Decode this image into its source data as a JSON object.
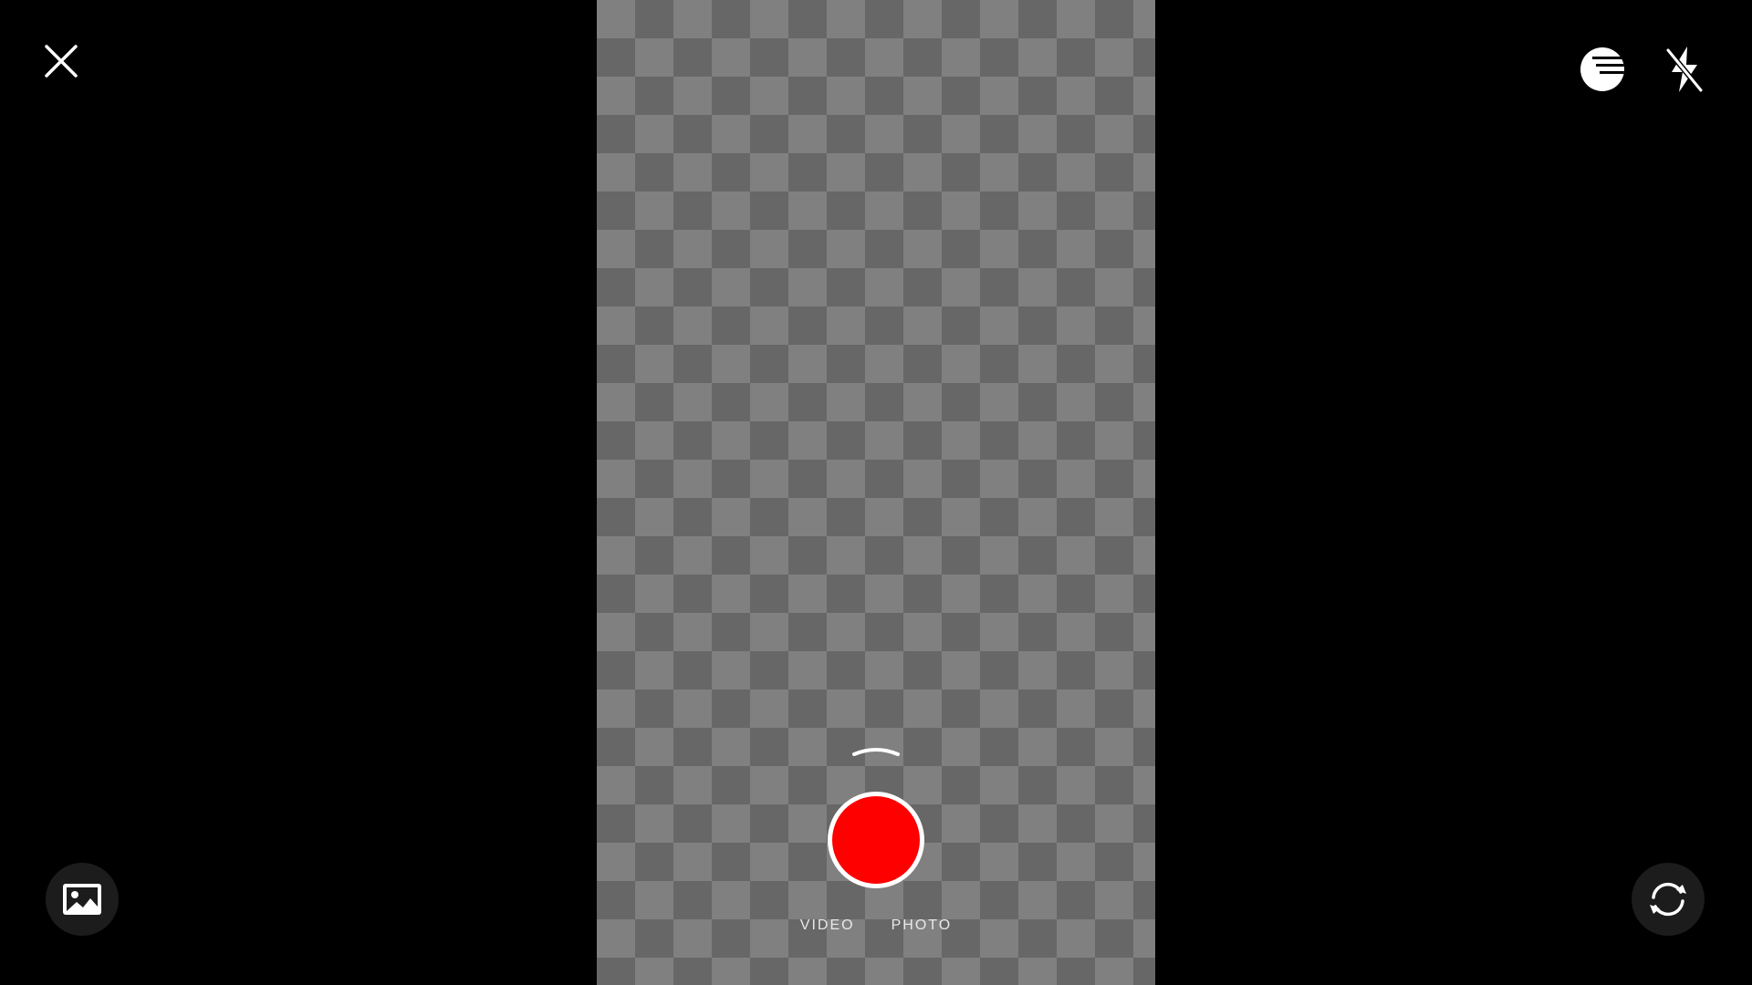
{
  "viewfinder": {
    "checker_light": "#808080",
    "checker_dark": "#676767"
  },
  "toolbar_top": {
    "close_icon": "close-icon",
    "filter_icon": "filter-icon",
    "flash_icon": "flash-off-icon"
  },
  "capture": {
    "shutter_color": "#ff0000",
    "ring_color": "#ffffff",
    "expand_icon": "chevron-up-icon",
    "modes": [
      {
        "label": "VIDEO"
      },
      {
        "label": "PHOTO"
      }
    ]
  },
  "toolbar_bottom": {
    "gallery_icon": "gallery-icon",
    "flip_icon": "flip-camera-icon"
  }
}
